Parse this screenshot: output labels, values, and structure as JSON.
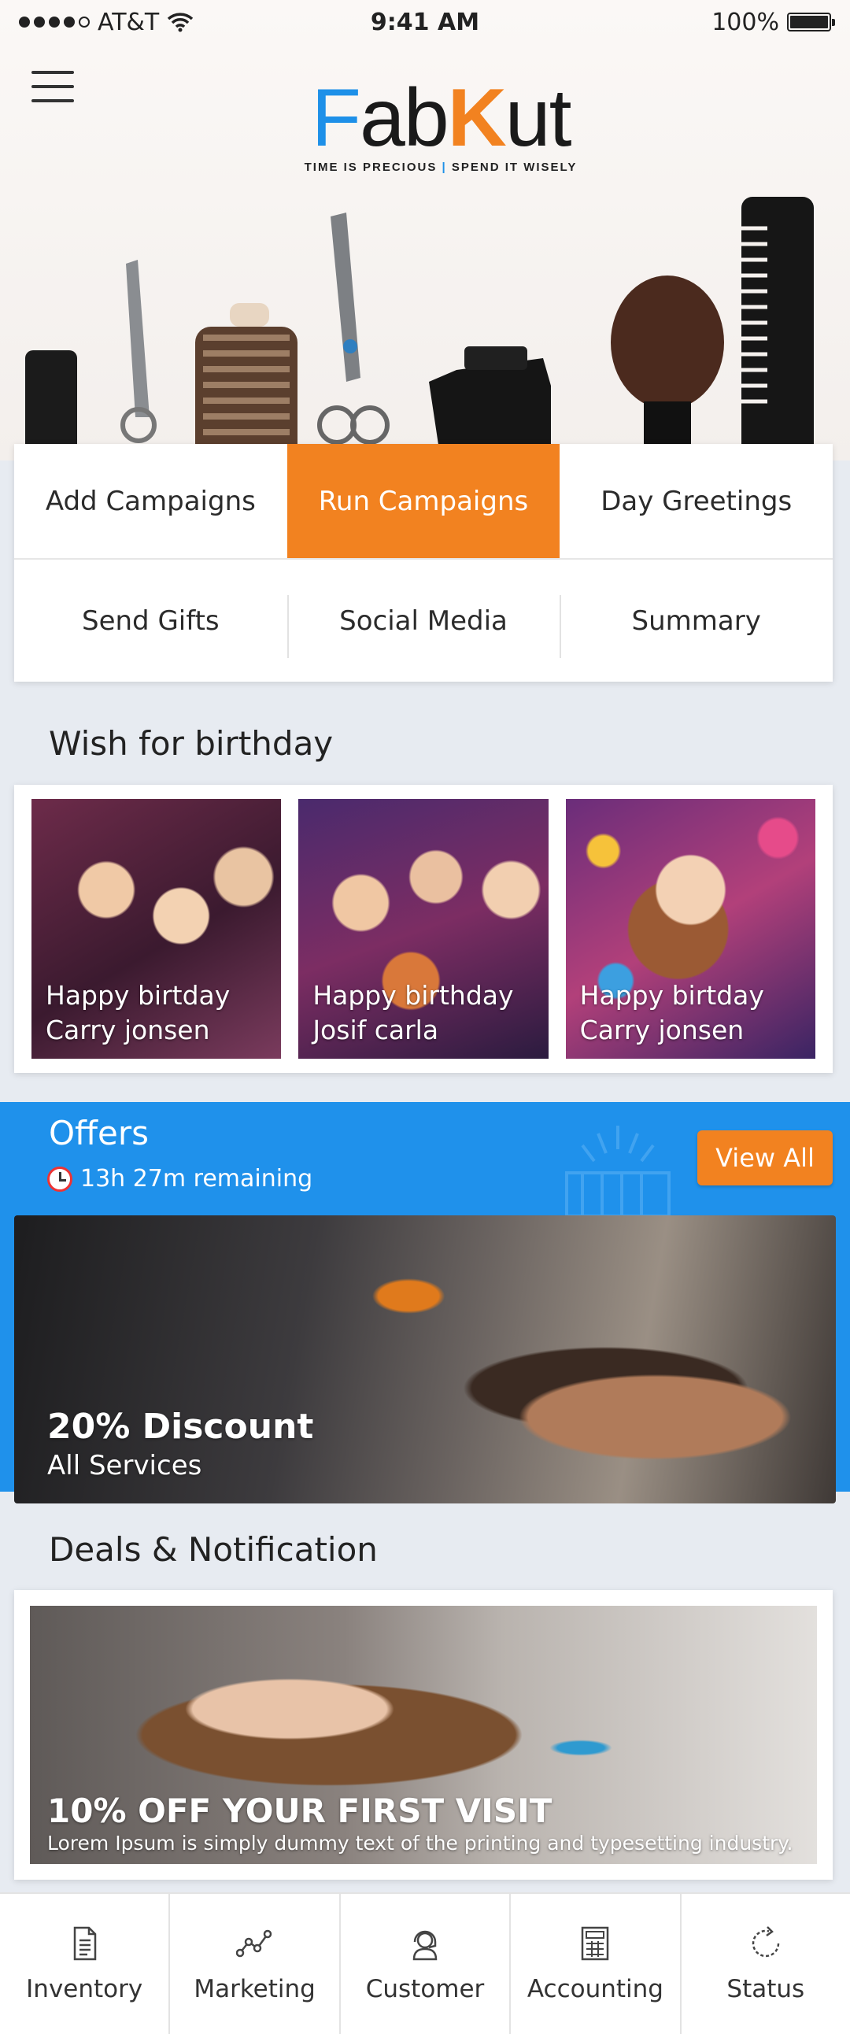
{
  "status_bar": {
    "carrier": "AT&T",
    "time": "9:41 AM",
    "battery": "100%"
  },
  "brand": {
    "logo_text": "FabKut",
    "tagline_left": "TIME IS PRECIOUS",
    "tagline_sep": "|",
    "tagline_right": "SPEND IT WISELY"
  },
  "tabs": [
    {
      "label": "Add Campaigns",
      "active": false
    },
    {
      "label": "Run Campaigns",
      "active": true
    },
    {
      "label": "Day Greetings",
      "active": false
    },
    {
      "label": "Send Gifts",
      "active": false
    },
    {
      "label": "Social Media",
      "active": false
    },
    {
      "label": "Summary",
      "active": false
    }
  ],
  "birthday": {
    "title": "Wish for birthday",
    "items": [
      {
        "line1": "Happy birtday",
        "line2": "Carry jonsen"
      },
      {
        "line1": "Happy birthday",
        "line2": "Josif carla"
      },
      {
        "line1": "Happy birtday",
        "line2": "Carry jonsen"
      }
    ]
  },
  "offers": {
    "title": "Offers",
    "timer": "13h 27m remaining",
    "view_all": "View All",
    "card": {
      "headline": "20% Discount",
      "subline": "All Services"
    }
  },
  "deals": {
    "title": "Deals & Notification",
    "card": {
      "headline": "10% OFF YOUR FIRST VISIT",
      "subline": "Lorem Ipsum is simply dummy text of the printing and typesetting industry."
    }
  },
  "bottom_nav": [
    {
      "label": "Inventory",
      "icon": "document-icon"
    },
    {
      "label": "Marketing",
      "icon": "chart-line-icon"
    },
    {
      "label": "Customer",
      "icon": "headset-icon"
    },
    {
      "label": "Accounting",
      "icon": "calculator-icon"
    },
    {
      "label": "Status",
      "icon": "refresh-icon"
    }
  ],
  "colors": {
    "accent": "#f28220",
    "blue": "#1f91eb",
    "background": "#e7ebf1"
  }
}
